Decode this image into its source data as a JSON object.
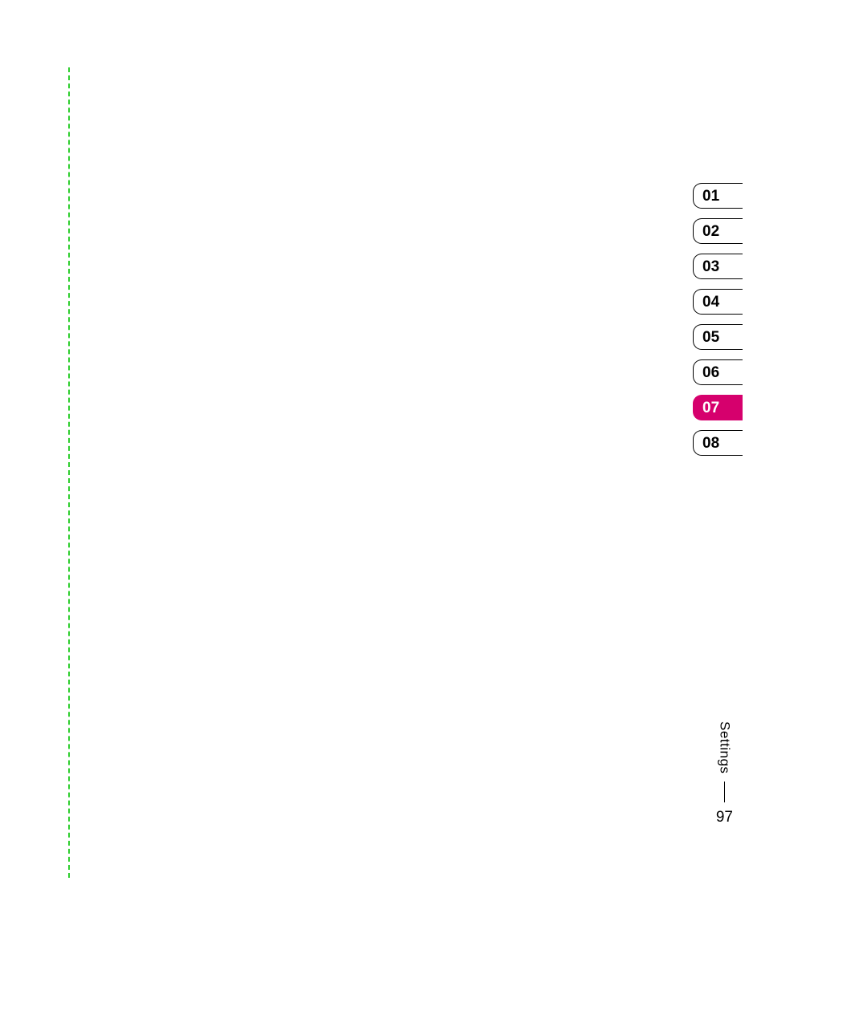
{
  "tabs": {
    "items": [
      {
        "label": "01",
        "active": false
      },
      {
        "label": "02",
        "active": false
      },
      {
        "label": "03",
        "active": false
      },
      {
        "label": "04",
        "active": false
      },
      {
        "label": "05",
        "active": false
      },
      {
        "label": "06",
        "active": false
      },
      {
        "label": "07",
        "active": true
      },
      {
        "label": "08",
        "active": false
      }
    ]
  },
  "footer": {
    "section_label": "Settings",
    "page_number": "97"
  },
  "colors": {
    "accent": "#d6006d",
    "fold_line": "#2ece2e"
  }
}
